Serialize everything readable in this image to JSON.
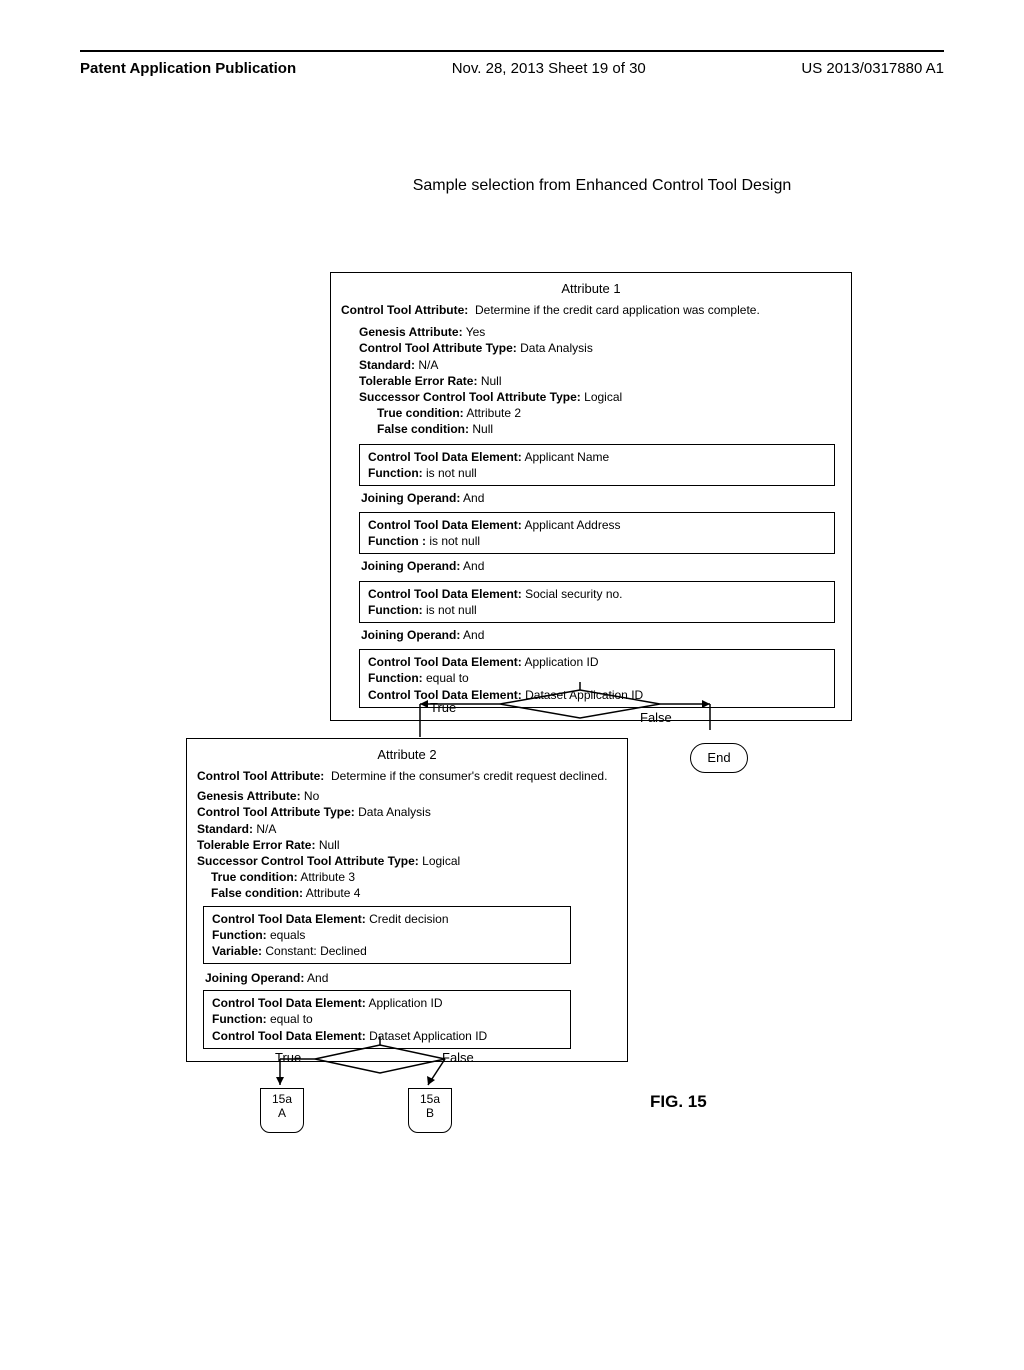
{
  "header": {
    "left": "Patent Application Publication",
    "center": "Nov. 28, 2013  Sheet 19 of 30",
    "right": "US 2013/0317880 A1"
  },
  "sample_title": "Sample selection from Enhanced Control Tool Design",
  "attr1": {
    "title": "Attribute 1",
    "cta_label": "Control Tool Attribute:",
    "cta_value": "Determine if the credit card application was complete.",
    "genesis_label": "Genesis Attribute:",
    "genesis_value": "Yes",
    "ctatype_label": "Control Tool Attribute Type:",
    "ctatype_value": "Data Analysis",
    "standard_label": "Standard:",
    "standard_value": "N/A",
    "tolerable_label": "Tolerable Error Rate:",
    "tolerable_value": "Null",
    "succ_label": "Successor Control Tool Attribute Type:",
    "succ_value": "Logical",
    "true_label": "True condition:",
    "true_value": "Attribute 2",
    "false_label": "False condition:",
    "false_value": "Null",
    "de1": {
      "de_label": "Control Tool Data Element:",
      "de_value": "Applicant Name",
      "fn_label": "Function:",
      "fn_value": "is not null"
    },
    "op1": {
      "label": "Joining Operand:",
      "value": "And"
    },
    "de2": {
      "de_label": "Control Tool Data Element:",
      "de_value": "Applicant Address",
      "fn_label": "Function :",
      "fn_value": "is not null"
    },
    "op2": {
      "label": "Joining Operand:",
      "value": "And"
    },
    "de3": {
      "de_label": "Control Tool Data Element:",
      "de_value": "Social security no.",
      "fn_label": "Function:",
      "fn_value": "is not null"
    },
    "op3": {
      "label": "Joining Operand:",
      "value": "And"
    },
    "de4": {
      "de_label": "Control Tool Data Element:",
      "de_value": "Application ID",
      "fn_label": "Function:",
      "fn_value": "equal to",
      "de2_label": "Control Tool Data Element:",
      "de2_value": "Dataset Application ID"
    }
  },
  "flow1": {
    "true": "True",
    "false": "False",
    "end": "End"
  },
  "attr2": {
    "title": "Attribute 2",
    "cta_label": "Control Tool Attribute:",
    "cta_value": "Determine if the consumer's credit request declined.",
    "genesis_label": "Genesis Attribute:",
    "genesis_value": "No",
    "ctatype_label": "Control Tool Attribute Type:",
    "ctatype_value": "Data Analysis",
    "standard_label": "Standard:",
    "standard_value": "N/A",
    "tolerable_label": "Tolerable Error Rate:",
    "tolerable_value": "Null",
    "succ_label": "Successor Control Tool Attribute Type:",
    "succ_value": "Logical",
    "true_label": "True condition:",
    "true_value": "Attribute 3",
    "false_label": "False condition:",
    "false_value": "Attribute 4",
    "de1": {
      "de_label": "Control Tool Data Element:",
      "de_value": "Credit decision",
      "fn_label": "Function:",
      "fn_value": "equals",
      "var_label": "Variable:",
      "var_value": "Constant: Declined"
    },
    "op1": {
      "label": "Joining Operand:",
      "value": "And"
    },
    "de2": {
      "de_label": "Control Tool Data Element:",
      "de_value": "Application ID",
      "fn_label": "Function:",
      "fn_value": "equal to",
      "de2_label": "Control Tool Data Element:",
      "de2_value": "Dataset Application ID"
    }
  },
  "flow2": {
    "true": "True",
    "false": "False"
  },
  "connectors": {
    "a_line1": "15a",
    "a_line2": "A",
    "b_line1": "15a",
    "b_line2": "B"
  },
  "fig": "FIG. 15"
}
